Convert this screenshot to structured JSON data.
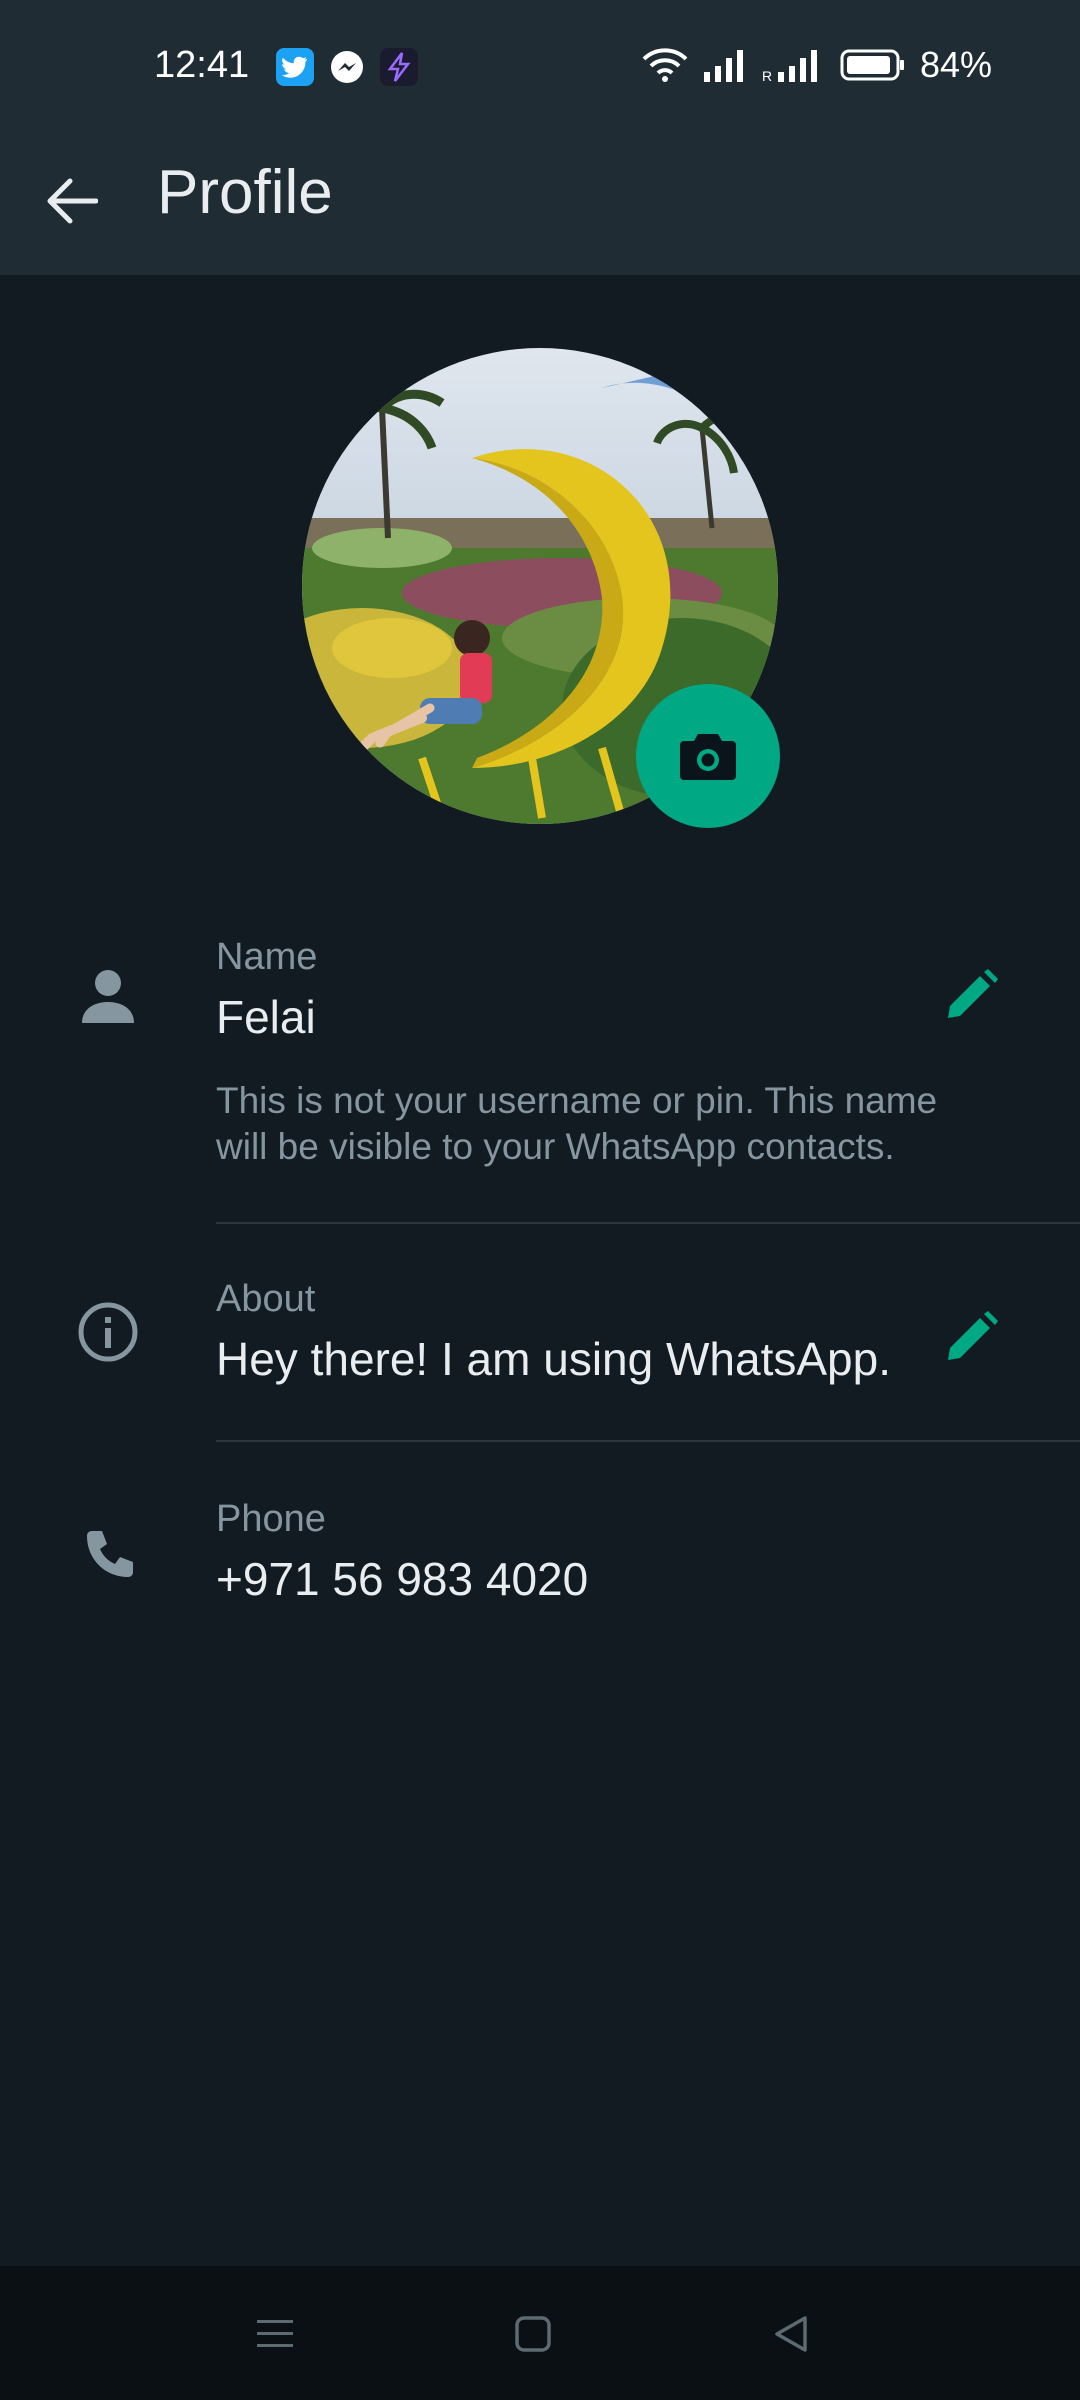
{
  "status_bar": {
    "time": "12:41",
    "notifications": [
      "twitter-icon",
      "messenger-icon",
      "bolt-app-icon"
    ],
    "battery_percent": "84%"
  },
  "app_bar": {
    "title": "Profile"
  },
  "profile_photo": {
    "description_icon": "profile-photo",
    "camera_button_icon": "camera-icon"
  },
  "fields": {
    "name": {
      "label": "Name",
      "value": "Felai",
      "hint": "This is not your username or pin. This name will be visible to your WhatsApp contacts."
    },
    "about": {
      "label": "About",
      "value": "Hey there! I am using WhatsApp."
    },
    "phone": {
      "label": "Phone",
      "value": "+971 56 983 4020"
    }
  },
  "colors": {
    "background": "#121b22",
    "header": "#1f2c34",
    "accent": "#00a884",
    "primary_text": "#e9edef",
    "secondary_text": "#8696a0"
  },
  "nav_bar": {
    "buttons": [
      "menu-icon",
      "home-icon",
      "back-triangle-icon"
    ]
  }
}
